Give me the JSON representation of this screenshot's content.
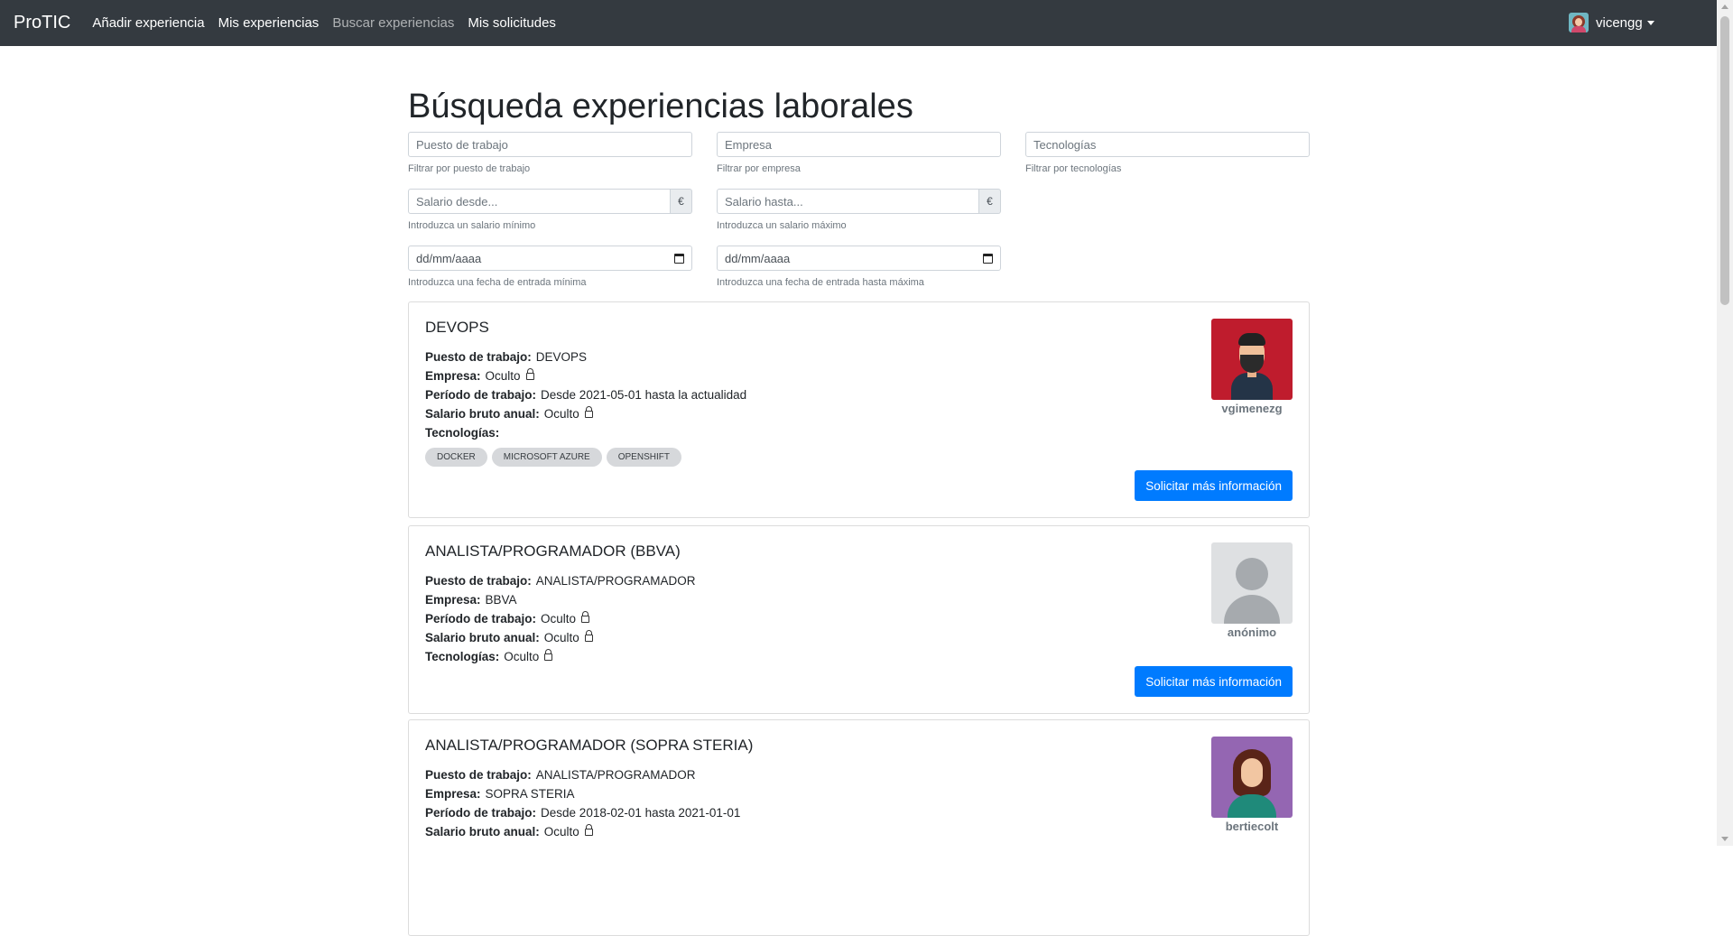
{
  "navbar": {
    "brand": "ProTIC",
    "links": [
      {
        "label": "Añadir experiencia"
      },
      {
        "label": "Mis experiencias"
      },
      {
        "label": "Buscar experiencias"
      },
      {
        "label": "Mis solicitudes"
      }
    ],
    "active_link": "Buscar experiencias",
    "user": {
      "name": "vicengg",
      "avatar": "woman-avatar-icon"
    }
  },
  "page": {
    "title": "Búsqueda experiencias laborales"
  },
  "filters": {
    "puesto": {
      "placeholder": "Puesto de trabajo",
      "value": "",
      "help": "Filtrar por puesto de trabajo"
    },
    "empresa": {
      "placeholder": "Empresa",
      "value": "",
      "help": "Filtrar por empresa"
    },
    "tecnologias": {
      "placeholder": "Tecnologías",
      "value": "",
      "help": "Filtrar por tecnologías"
    },
    "salario_desde": {
      "placeholder": "Salario desde...",
      "value": "",
      "addon": "€",
      "help": "Introduzca un salario mínimo"
    },
    "salario_hasta": {
      "placeholder": "Salario hasta...",
      "value": "",
      "addon": "€",
      "help": "Introduzca un salario máximo"
    },
    "fecha_desde": {
      "placeholder": "dd/mm/aaaa",
      "help": "Introduzca una fecha de entrada mínima",
      "icon": "calendar-icon"
    },
    "fecha_hasta": {
      "placeholder": "dd/mm/aaaa",
      "help": "Introduzca una fecha de entrada hasta máxima",
      "icon": "calendar-icon"
    }
  },
  "labels": {
    "puesto": "Puesto de trabajo:",
    "empresa": "Empresa:",
    "periodo": "Período de trabajo:",
    "salario": "Salario bruto anual:",
    "tecnologias": "Tecnologías:"
  },
  "results": [
    {
      "title": "DEVOPS",
      "puesto": "DEVOPS",
      "empresa": "Oculto",
      "empresa_hidden": true,
      "periodo": "Desde 2021-05-01 hasta la actualidad",
      "periodo_hidden": false,
      "salario": "Oculto",
      "salario_hidden": true,
      "tecnologias": [
        "DOCKER",
        "MICROSOFT AZURE",
        "OPENSHIFT"
      ],
      "user": "vgimenezg",
      "avatar": "bearded-man-avatar-icon",
      "avatar_bg": "#bf1c2d",
      "button": "Solicitar más información"
    },
    {
      "title": "ANALISTA/PROGRAMADOR (BBVA)",
      "puesto": "ANALISTA/PROGRAMADOR",
      "empresa": "BBVA",
      "empresa_hidden": false,
      "periodo": "Oculto",
      "periodo_hidden": true,
      "salario": "Oculto",
      "salario_hidden": true,
      "tecnologias_text": "Oculto",
      "tecnologias_hidden": true,
      "user": "anónimo",
      "avatar": "anonymous-user-icon",
      "avatar_bg": "#dee0e2",
      "button": "Solicitar más información"
    },
    {
      "title": "ANALISTA/PROGRAMADOR (SOPRA STERIA)",
      "puesto": "ANALISTA/PROGRAMADOR",
      "empresa": "SOPRA STERIA",
      "empresa_hidden": false,
      "periodo": "Desde 2018-02-01 hasta 2021-01-01",
      "periodo_hidden": false,
      "salario": "Oculto",
      "salario_hidden": true,
      "user": "bertiecolt",
      "avatar": "woman-avatar-icon",
      "avatar_bg": "#9466b2"
    }
  ],
  "colors": {
    "navbar": "#343a40",
    "primary_button": "#007bff",
    "badge": "#d6d8db"
  }
}
